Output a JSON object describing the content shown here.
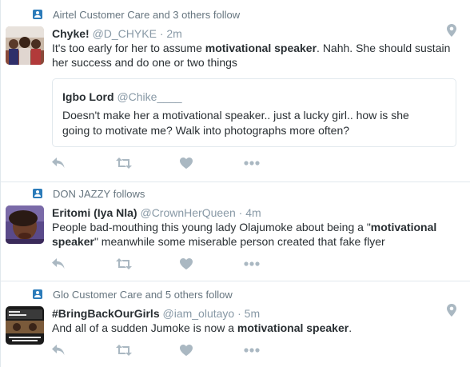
{
  "colors": {
    "accent": "#2b7bb9",
    "text": "#292f33",
    "muted": "#8899a6",
    "context": "#66757f",
    "action_icon": "#aab8c2",
    "border": "#e1e8ed"
  },
  "tweets": [
    {
      "context": "Airtel Customer Care and 3 others follow",
      "context_icon": "follow-context-icon",
      "fullname": "Chyke!",
      "username": "@D_CHYKE",
      "dot": "·",
      "time": "2m",
      "text_before": "It's too early for her to assume ",
      "text_bold": "motivational speaker",
      "text_after": ". Nahh. She should sustain her success and do one or two things",
      "has_location": true,
      "quote": {
        "fullname": "Igbo Lord",
        "username": "@Chike____",
        "text": "Doesn't make her a motivational speaker.. just a lucky girl.. how is she going to motivate me? Walk into photographs more often?"
      },
      "actions": [
        "reply-icon",
        "retweet-icon",
        "like-icon",
        "more-icon"
      ]
    },
    {
      "context": "DON JAZZY follows",
      "context_icon": "follow-context-icon",
      "fullname": "Eritomi (Iya Nla)",
      "username": "@CrownHerQueen",
      "dot": "·",
      "time": "4m",
      "text_before": "People bad-mouthing this young lady Olajumoke about being a \"",
      "text_bold": "motivational speaker",
      "text_after": "\" meanwhile some miserable person created that fake flyer",
      "has_location": false,
      "actions": [
        "reply-icon",
        "retweet-icon",
        "like-icon",
        "more-icon"
      ]
    },
    {
      "context": "Glo Customer Care and 5 others follow",
      "context_icon": "follow-context-icon",
      "fullname": "#BringBackOurGirls",
      "username": "@iam_olutayo",
      "dot": "·",
      "time": "5m",
      "text_before": "And all of a sudden Jumoke is now a ",
      "text_bold": "motivational speaker",
      "text_after": ".",
      "has_location": true,
      "actions": [
        "reply-icon",
        "retweet-icon",
        "like-icon",
        "more-icon"
      ]
    }
  ]
}
